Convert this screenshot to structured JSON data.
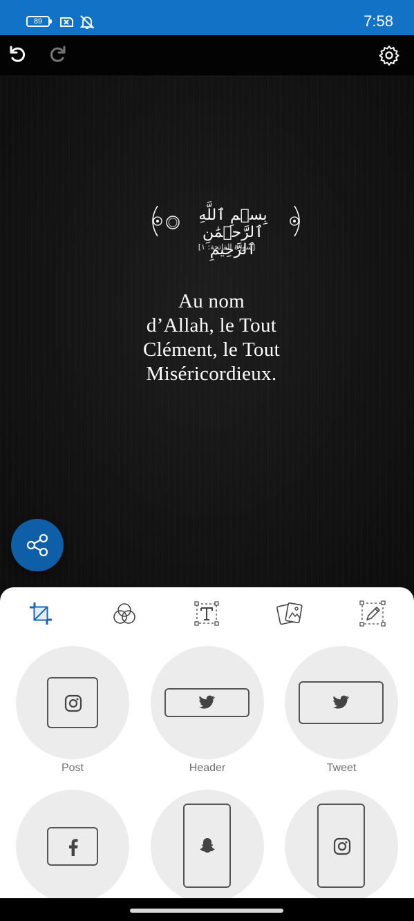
{
  "status_bar": {
    "battery": "89",
    "time": "7:58",
    "background": "#1273c6"
  },
  "toolbar": {
    "undo_icon": "undo-icon",
    "redo_icon": "redo-icon",
    "settings_icon": "gear-icon"
  },
  "canvas": {
    "arabic_bismillah": "بِسۡمِ ٱللَّهِ ٱلرَّحۡمَٰنِ ٱلرَّحِيمِ",
    "surah_reference": "[سورة الفاتحة: ١]",
    "verse_lines": [
      "Au nom",
      "d’Allah, le Tout",
      "Clément, le Tout",
      "Miséricordieux."
    ],
    "share_icon": "share-icon",
    "share_color": "#0f5fa8"
  },
  "editor_tabs": [
    {
      "icon": "crop-icon",
      "active": true
    },
    {
      "icon": "filters-icon",
      "active": false
    },
    {
      "icon": "text-icon",
      "active": false
    },
    {
      "icon": "images-icon",
      "active": false
    },
    {
      "icon": "edit-icon",
      "active": false
    }
  ],
  "accent_color": "#1565c0",
  "formats": [
    {
      "label": "Post",
      "icon": "instagram-icon"
    },
    {
      "label": "Header",
      "icon": "twitter-icon"
    },
    {
      "label": "Tweet",
      "icon": "twitter-icon"
    },
    {
      "label": "",
      "icon": "facebook-icon"
    },
    {
      "label": "",
      "icon": "snapchat-icon"
    },
    {
      "label": "",
      "icon": "instagram-icon"
    }
  ]
}
